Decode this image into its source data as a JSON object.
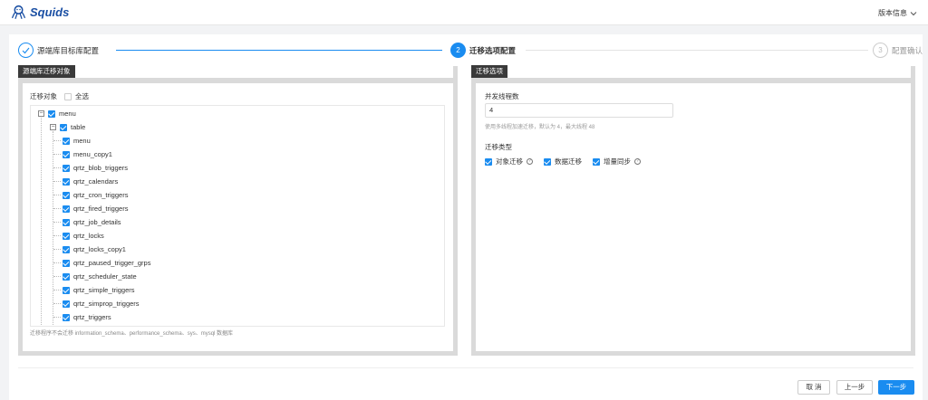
{
  "app": {
    "name": "Squids",
    "version_menu": "版本信息",
    "brand_color": "#1a4fa3",
    "accent_color": "#1a8cf0"
  },
  "steps": [
    {
      "number": "1",
      "label": "源端库目标库配置",
      "state": "done"
    },
    {
      "number": "2",
      "label": "迁移选项配置",
      "state": "active"
    },
    {
      "number": "3",
      "label": "配置确认",
      "state": "wait"
    }
  ],
  "left_panel": {
    "title": "源端库迁移对象",
    "object_label": "迁移对象",
    "select_all_label": "全选",
    "select_all_checked": false,
    "tree_root": "menu",
    "tree_group": "table",
    "tables": [
      "menu",
      "menu_copy1",
      "qrtz_blob_triggers",
      "qrtz_calendars",
      "qrtz_cron_triggers",
      "qrtz_fired_triggers",
      "qrtz_job_details",
      "qrtz_locks",
      "qrtz_locks_copy1",
      "qrtz_paused_trigger_grps",
      "qrtz_scheduler_state",
      "qrtz_simple_triggers",
      "qrtz_simprop_triggers",
      "qrtz_triggers"
    ],
    "note": "迁移程序不会迁移 information_schema、performance_schema、sys、mysql 数据库"
  },
  "right_panel": {
    "title": "迁移选项",
    "threads_label": "并发线程数",
    "threads_value": "4",
    "threads_hint": "使用多线程加速迁移，默认为 4，最大线程 48",
    "type_label": "迁移类型",
    "types": [
      {
        "label": "对象迁移",
        "checked": true,
        "help": true
      },
      {
        "label": "数据迁移",
        "checked": true,
        "help": false
      },
      {
        "label": "增量同步",
        "checked": true,
        "help": true
      }
    ]
  },
  "buttons": {
    "cancel": "取 消",
    "prev": "上一步",
    "next": "下一步"
  },
  "icons": {
    "step_done": "check-icon",
    "expand": "minus-square-icon",
    "help": "question-circle-icon",
    "dropdown": "chevron-down-icon",
    "logo": "octopus-logo-icon"
  }
}
